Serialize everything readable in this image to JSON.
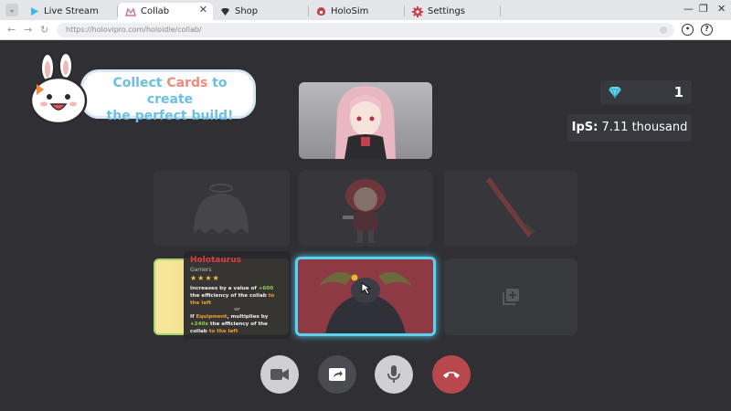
{
  "browser": {
    "tabs": [
      {
        "label": "Live Stream",
        "icon": "play-icon"
      },
      {
        "label": "Collab",
        "icon": "collab-icon"
      },
      {
        "label": "Shop",
        "icon": "diamond-icon"
      },
      {
        "label": "HoloSim",
        "icon": "holosim-icon"
      },
      {
        "label": "Settings",
        "icon": "gear-icon"
      }
    ],
    "active_tab": "Collab",
    "url": "https://holovipro.com/holoidle/collab/"
  },
  "banner": {
    "line1_pre": "Collect ",
    "line1_highlight": "Cards",
    "line1_post": " to create",
    "line2": "the perfect build!"
  },
  "stats": {
    "gems": "1",
    "ips_label": "IpS:",
    "ips_value": "7.11 thousand"
  },
  "tooltip": {
    "title": "Holotaurus",
    "category": "Gamers",
    "stars": "★★★★",
    "line_a_pre": "Increases by a value of ",
    "line_a_val": "+600",
    "line_a_mid": " the efficiency of the collab ",
    "line_a_post": "to the left",
    "or": "or",
    "line_b_pre": "If ",
    "line_b_kw": "Equipment",
    "line_b_mid": ", multiplies by ",
    "line_b_val": "+240x",
    "line_b_mid2": " the efficiency of the collab ",
    "line_b_post": "to the left"
  },
  "controls": [
    {
      "name": "camera-button",
      "icon": "video-camera-icon",
      "color": "#d0d0d2"
    },
    {
      "name": "screen-share-button",
      "icon": "screen-share-icon",
      "color": "#4a4b50"
    },
    {
      "name": "microphone-button",
      "icon": "microphone-icon",
      "color": "#d0d0d2"
    },
    {
      "name": "end-call-button",
      "icon": "hang-up-icon",
      "color": "#b9484e"
    }
  ],
  "colors": {
    "background": "#303034",
    "active_card_border": "#5ed1ee",
    "end_call": "#b9484e",
    "gem": "#5fd6e8"
  }
}
